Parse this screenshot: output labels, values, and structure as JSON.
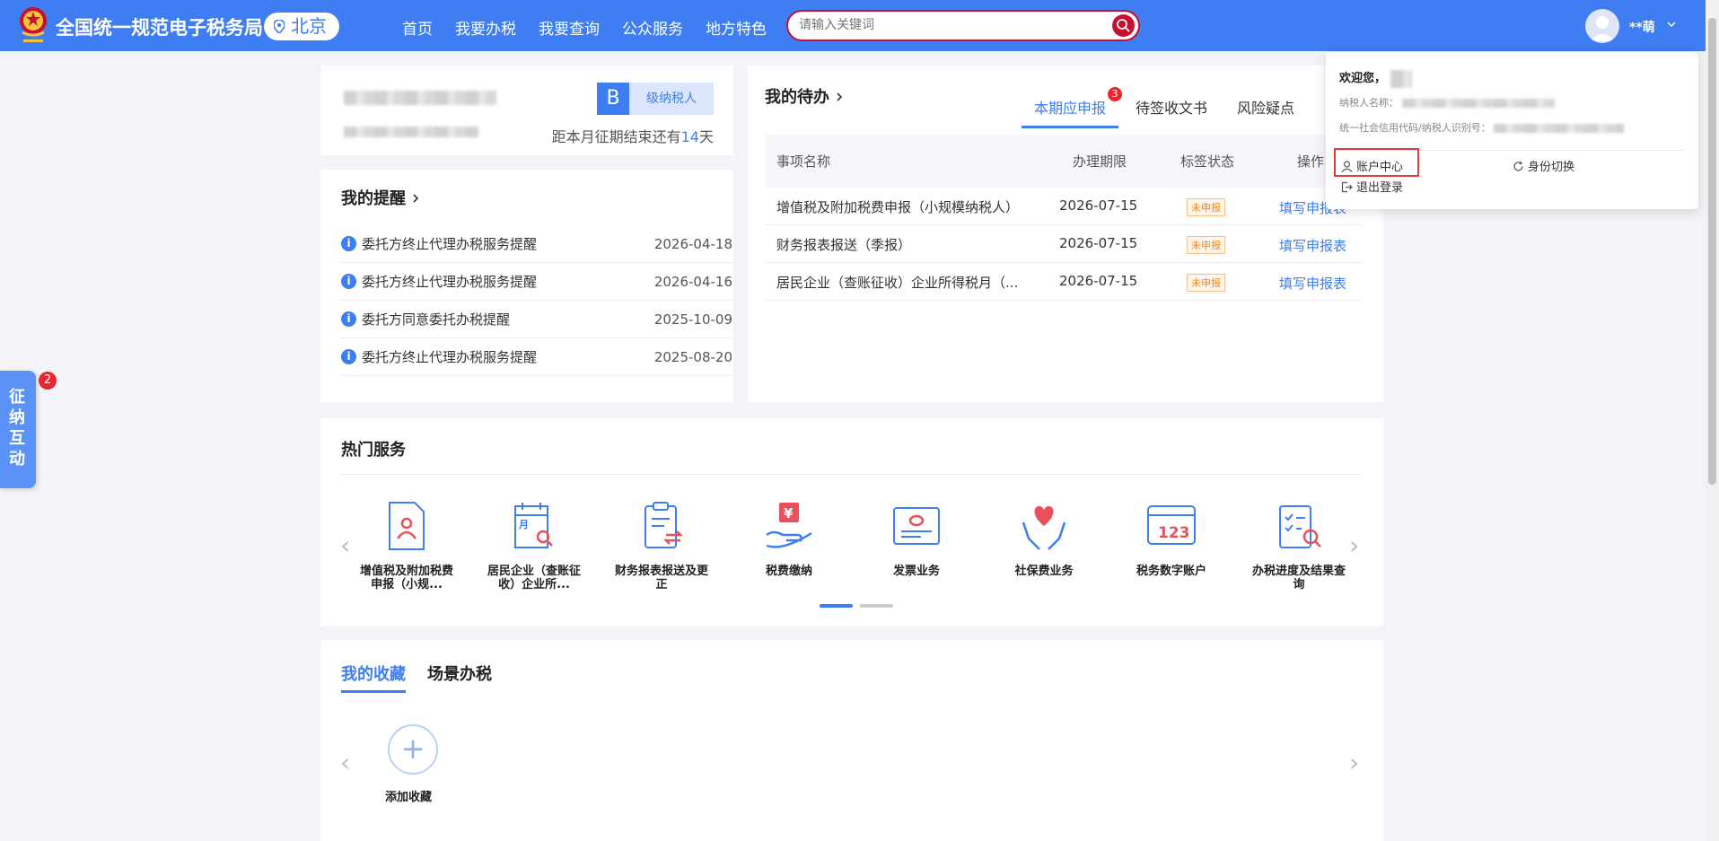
{
  "header": {
    "title": "全国统一规范电子税务局",
    "city": "北京",
    "nav": [
      "首页",
      "我要办税",
      "我要查询",
      "公众服务",
      "地方特色"
    ],
    "search_placeholder": "请输入关键词",
    "user_name": "**萌"
  },
  "taxpayer_card": {
    "level_badge": "B",
    "level_label": "级纳税人",
    "deadline_prefix": "距本月征期结束还有",
    "deadline_days": "14",
    "deadline_suffix": "天"
  },
  "reminders": {
    "title": "我的提醒",
    "items": [
      {
        "text": "委托方终止代理办税服务提醒",
        "date": "2026-04-18"
      },
      {
        "text": "委托方终止代理办税服务提醒",
        "date": "2026-04-16"
      },
      {
        "text": "委托方同意委托办税提醒",
        "date": "2025-10-09"
      },
      {
        "text": "委托方终止代理办税服务提醒",
        "date": "2025-08-20"
      }
    ]
  },
  "todo": {
    "title": "我的待办",
    "tabs": [
      "本期应申报",
      "待签收文书",
      "风险疑点"
    ],
    "tab_badge": "3",
    "columns": [
      "事项名称",
      "办理期限",
      "标签状态",
      "操作"
    ],
    "rows": [
      {
        "name": "增值税及附加税费申报（小规模纳税人）",
        "deadline": "2026-07-15",
        "status": "未申报",
        "action": "填写申报表"
      },
      {
        "name": "财务报表报送（季报）",
        "deadline": "2026-07-15",
        "status": "未申报",
        "action": "填写申报表"
      },
      {
        "name": "居民企业（查账征收）企业所得税月（...",
        "deadline": "2026-07-15",
        "status": "未申报",
        "action": "填写申报表"
      }
    ]
  },
  "hot_services": {
    "title": "热门服务",
    "items": [
      {
        "label": "增值税及附加税费申报（小规...",
        "icon": "document-person-icon"
      },
      {
        "label": "居民企业（查账征收）企业所...",
        "icon": "calendar-search-icon"
      },
      {
        "label": "财务报表报送及更正",
        "icon": "clipboard-exchange-icon"
      },
      {
        "label": "税费缴纳",
        "icon": "hand-yuan-icon"
      },
      {
        "label": "发票业务",
        "icon": "invoice-icon"
      },
      {
        "label": "社保费业务",
        "icon": "hands-heart-icon"
      },
      {
        "label": "税务数字账户",
        "icon": "card-123-icon"
      },
      {
        "label": "办税进度及结果查询",
        "icon": "checklist-search-icon"
      }
    ]
  },
  "favorites": {
    "tabs": [
      "我的收藏",
      "场景办税"
    ],
    "add_label": "添加收藏"
  },
  "float_tab": {
    "label": "征纳互动",
    "badge": "2"
  },
  "user_dropdown": {
    "welcome": "欢迎您，",
    "taxpayer_name_label": "纳税人名称：",
    "credit_code_label": "统一社会信用代码/纳税人识别号：",
    "account_center": "账户中心",
    "switch_identity": "身份切换",
    "logout": "退出登录"
  },
  "colors": {
    "primary": "#3e7df2",
    "search_border": "#c8102e",
    "badge": "#e8262c",
    "highlight": "#e23b3b"
  }
}
